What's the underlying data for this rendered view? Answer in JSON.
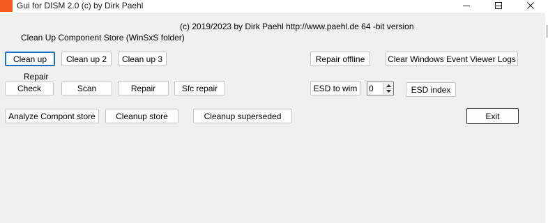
{
  "window": {
    "title": "Gui for DISM 2.0 (c) by Dirk Paehl",
    "controls": {
      "minimize": "minimize-icon",
      "maximize": "maximize-icon",
      "close": "close-icon"
    },
    "icon_color": "#f25a1f"
  },
  "header": {
    "copyright": "(c) 2019/2023 by Dirk Paehl http://www.paehl.de 64 -bit version"
  },
  "cleanup_section": {
    "label": "Clean Up Component Store (WinSxS folder)",
    "buttons": {
      "clean_up": "Clean up",
      "clean_up_2": "Clean up 2",
      "clean_up_3": "Clean up 3"
    }
  },
  "repair_section": {
    "label": "Repair",
    "buttons": {
      "check": "Check",
      "scan": "Scan",
      "repair": "Repair",
      "sfc_repair": "Sfc repair"
    }
  },
  "store_buttons": {
    "analyze": "Analyze Compont store",
    "cleanup_store": "Cleanup store",
    "cleanup_superseded": "Cleanup superseded"
  },
  "right_buttons": {
    "repair_offline": "Repair offline",
    "clear_event_logs": "Clear Windows Event Viewer Logs",
    "esd_to_wim": "ESD to wim",
    "esd_index": "ESD index",
    "exit": "Exit"
  },
  "esd_index_spinner": {
    "value": "0"
  },
  "colors": {
    "focus_border": "#1b6fc2",
    "client_background": "#f0f0f0"
  }
}
